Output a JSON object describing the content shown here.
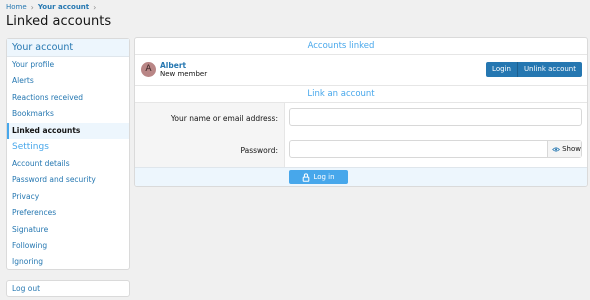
{
  "breadcrumb": {
    "home": "Home",
    "current": "Your account"
  },
  "page": {
    "title": "Linked accounts"
  },
  "sidebar": {
    "heading": "Your account",
    "items": [
      {
        "label": "Your profile"
      },
      {
        "label": "Alerts"
      },
      {
        "label": "Reactions received"
      },
      {
        "label": "Bookmarks"
      },
      {
        "label": "Linked accounts"
      }
    ],
    "settings_heading": "Settings",
    "settings_items": [
      {
        "label": "Account details"
      },
      {
        "label": "Password and security"
      },
      {
        "label": "Privacy"
      },
      {
        "label": "Preferences"
      },
      {
        "label": "Signature"
      },
      {
        "label": "Following"
      },
      {
        "label": "Ignoring"
      }
    ],
    "logout": "Log out"
  },
  "linked": {
    "heading": "Accounts linked",
    "account": {
      "avatar_letter": "A",
      "name": "Albert",
      "role": "New member"
    },
    "login_label": "Login",
    "unlink_label": "Unlink account"
  },
  "link_form": {
    "heading": "Link an account",
    "name_label": "Your name or email address:",
    "password_label": "Password:",
    "show_label": "Show",
    "submit_label": "Log in"
  },
  "colors": {
    "accent": "#2577b1",
    "accent_light": "#47a7eb",
    "tint": "#edf6fd"
  }
}
